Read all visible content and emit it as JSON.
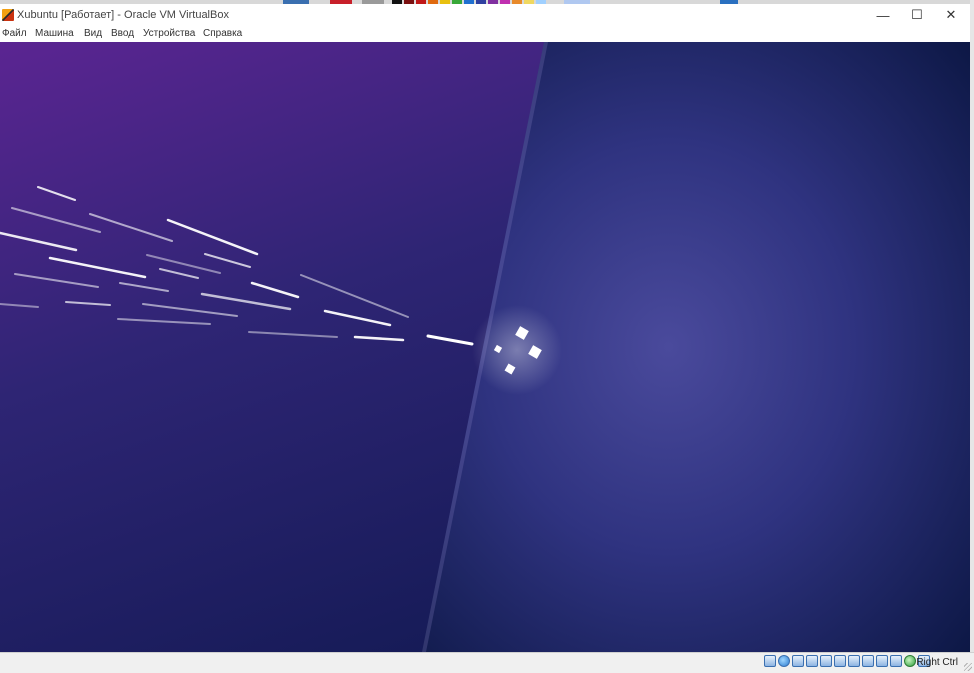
{
  "window": {
    "title": "Xubuntu [Работает] - Oracle VM VirtualBox",
    "controls": {
      "minimize": "—",
      "maximize": "☐",
      "close": "✕"
    }
  },
  "menu": {
    "items": [
      "Файл",
      "Машина",
      "Вид",
      "Ввод",
      "Устройства",
      "Справка"
    ]
  },
  "vm_screen": {
    "description_colors": {
      "left_top": "#5a2391",
      "left_bottom": "#141a52",
      "right_top": "#4a3a8e",
      "right_bottom": "#0f1a46"
    }
  },
  "statusbar": {
    "icons": [
      "hard-disk-icon",
      "optical-disk-icon",
      "audio-icon",
      "network-icon",
      "usb-icon",
      "shared-folders-icon",
      "display-icon",
      "video-capture-icon",
      "cpu-icon",
      "mouse-integration-icon",
      "settings-icon",
      "arrow-icon"
    ],
    "host_key": "Right Ctrl"
  }
}
